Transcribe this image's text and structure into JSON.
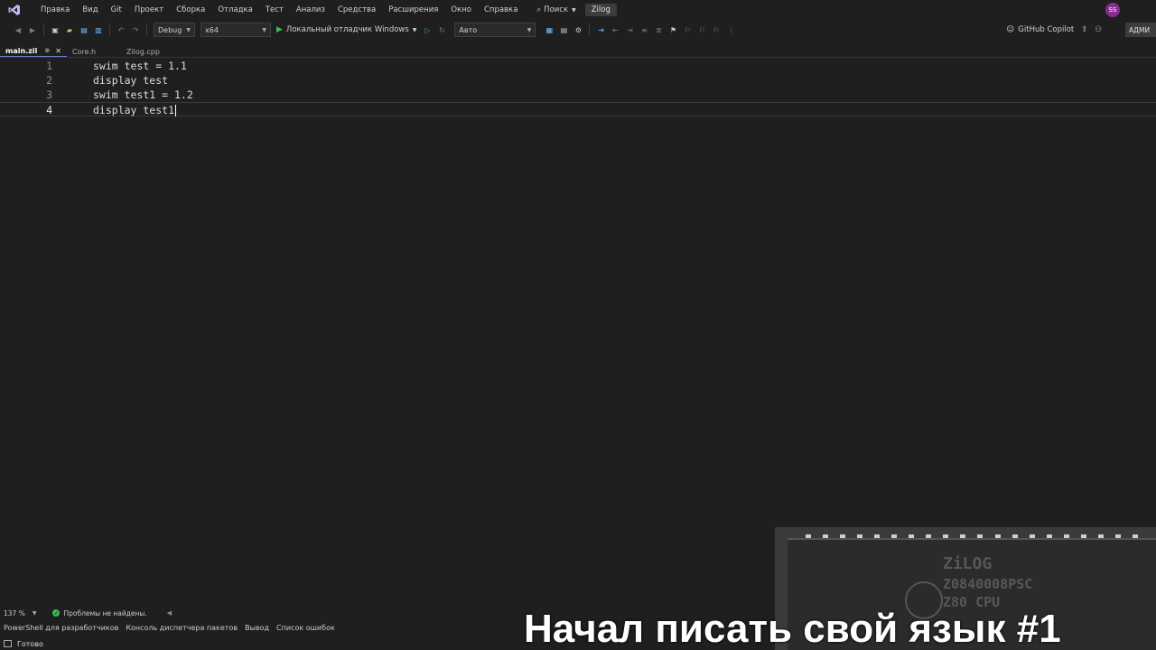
{
  "menu": {
    "items": [
      "Правка",
      "Вид",
      "Git",
      "Проект",
      "Сборка",
      "Отладка",
      "Тест",
      "Анализ",
      "Средства",
      "Расширения",
      "Окно",
      "Справка"
    ],
    "search_label": "Поиск",
    "solution_name": "Zilog",
    "avatar_initials": "SS"
  },
  "toolbar": {
    "configuration": "Debug",
    "platform": "x64",
    "run_label": "Локальный отладчик Windows",
    "target": "Авто",
    "copilot_label": "GitHub Copilot",
    "admin_label": "АДМИ"
  },
  "tabs": [
    {
      "label": "main.zil",
      "active": true
    },
    {
      "label": "Core.h",
      "active": false
    },
    {
      "label": "Zilog.cpp",
      "active": false
    }
  ],
  "editor": {
    "lines": [
      {
        "num": "1",
        "code": "swim test = 1.1"
      },
      {
        "num": "2",
        "code": "display test"
      },
      {
        "num": "3",
        "code": "swim test1 = 1.2"
      },
      {
        "num": "4",
        "code": "display test1"
      }
    ],
    "current_line": 4
  },
  "editor_status": {
    "zoom": "137 %",
    "problems": "Проблемы не найдены."
  },
  "bottom_tabs": [
    "PowerShell для разработчиков",
    "Консоль диспетчера пакетов",
    "Вывод",
    "Список ошибок"
  ],
  "statusbar": {
    "text": "Готово"
  },
  "overlay": {
    "caption": "Начал писать свой язык #1",
    "chip_lines": [
      "ZiLOG",
      "Z0840008PSC",
      "Z80 CPU"
    ]
  },
  "colors": {
    "background": "#1f1f1f",
    "accent": "#6f7fd3",
    "run_green": "#3fb950",
    "avatar": "#8a2d8f"
  }
}
